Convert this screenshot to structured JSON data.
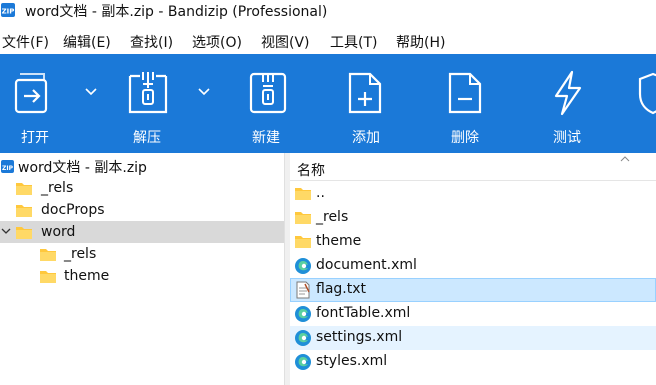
{
  "window": {
    "title": "word文档 - 副本.zip - Bandizip (Professional)"
  },
  "menu": [
    "文件(F)",
    "编辑(E)",
    "查找(I)",
    "选项(O)",
    "视图(V)",
    "工具(T)",
    "帮助(H)"
  ],
  "toolbar": {
    "open": "打开",
    "extract": "解压",
    "new": "新建",
    "add": "添加",
    "delete": "删除",
    "test": "测试"
  },
  "tree": {
    "root": "word文档 - 副本.zip",
    "items": [
      {
        "label": "_rels"
      },
      {
        "label": "docProps"
      },
      {
        "label": "word"
      },
      {
        "label": "_rels"
      },
      {
        "label": "theme"
      }
    ]
  },
  "list": {
    "column_name": "名称",
    "files": [
      {
        "name": "..",
        "type": "folder"
      },
      {
        "name": "_rels",
        "type": "folder"
      },
      {
        "name": "theme",
        "type": "folder"
      },
      {
        "name": "document.xml",
        "type": "edge-xml"
      },
      {
        "name": "flag.txt",
        "type": "text"
      },
      {
        "name": "fontTable.xml",
        "type": "edge-xml"
      },
      {
        "name": "settings.xml",
        "type": "edge-xml"
      },
      {
        "name": "styles.xml",
        "type": "edge-xml"
      }
    ]
  },
  "colors": {
    "toolbar": "#1b79d8",
    "folder": "#ffc83d",
    "selection": "#cce8ff",
    "tree_selection": "#d9d9d9"
  }
}
